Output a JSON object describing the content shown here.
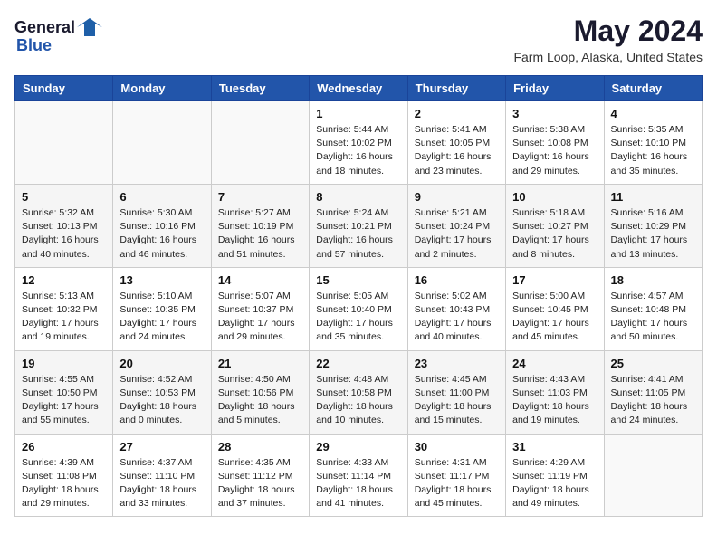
{
  "header": {
    "logo_general": "General",
    "logo_blue": "Blue",
    "title": "May 2024",
    "subtitle": "Farm Loop, Alaska, United States"
  },
  "days_of_week": [
    "Sunday",
    "Monday",
    "Tuesday",
    "Wednesday",
    "Thursday",
    "Friday",
    "Saturday"
  ],
  "weeks": [
    [
      {
        "day": "",
        "details": []
      },
      {
        "day": "",
        "details": []
      },
      {
        "day": "",
        "details": []
      },
      {
        "day": "1",
        "details": [
          "Sunrise: 5:44 AM",
          "Sunset: 10:02 PM",
          "Daylight: 16 hours",
          "and 18 minutes."
        ]
      },
      {
        "day": "2",
        "details": [
          "Sunrise: 5:41 AM",
          "Sunset: 10:05 PM",
          "Daylight: 16 hours",
          "and 23 minutes."
        ]
      },
      {
        "day": "3",
        "details": [
          "Sunrise: 5:38 AM",
          "Sunset: 10:08 PM",
          "Daylight: 16 hours",
          "and 29 minutes."
        ]
      },
      {
        "day": "4",
        "details": [
          "Sunrise: 5:35 AM",
          "Sunset: 10:10 PM",
          "Daylight: 16 hours",
          "and 35 minutes."
        ]
      }
    ],
    [
      {
        "day": "5",
        "details": [
          "Sunrise: 5:32 AM",
          "Sunset: 10:13 PM",
          "Daylight: 16 hours",
          "and 40 minutes."
        ]
      },
      {
        "day": "6",
        "details": [
          "Sunrise: 5:30 AM",
          "Sunset: 10:16 PM",
          "Daylight: 16 hours",
          "and 46 minutes."
        ]
      },
      {
        "day": "7",
        "details": [
          "Sunrise: 5:27 AM",
          "Sunset: 10:19 PM",
          "Daylight: 16 hours",
          "and 51 minutes."
        ]
      },
      {
        "day": "8",
        "details": [
          "Sunrise: 5:24 AM",
          "Sunset: 10:21 PM",
          "Daylight: 16 hours",
          "and 57 minutes."
        ]
      },
      {
        "day": "9",
        "details": [
          "Sunrise: 5:21 AM",
          "Sunset: 10:24 PM",
          "Daylight: 17 hours",
          "and 2 minutes."
        ]
      },
      {
        "day": "10",
        "details": [
          "Sunrise: 5:18 AM",
          "Sunset: 10:27 PM",
          "Daylight: 17 hours",
          "and 8 minutes."
        ]
      },
      {
        "day": "11",
        "details": [
          "Sunrise: 5:16 AM",
          "Sunset: 10:29 PM",
          "Daylight: 17 hours",
          "and 13 minutes."
        ]
      }
    ],
    [
      {
        "day": "12",
        "details": [
          "Sunrise: 5:13 AM",
          "Sunset: 10:32 PM",
          "Daylight: 17 hours",
          "and 19 minutes."
        ]
      },
      {
        "day": "13",
        "details": [
          "Sunrise: 5:10 AM",
          "Sunset: 10:35 PM",
          "Daylight: 17 hours",
          "and 24 minutes."
        ]
      },
      {
        "day": "14",
        "details": [
          "Sunrise: 5:07 AM",
          "Sunset: 10:37 PM",
          "Daylight: 17 hours",
          "and 29 minutes."
        ]
      },
      {
        "day": "15",
        "details": [
          "Sunrise: 5:05 AM",
          "Sunset: 10:40 PM",
          "Daylight: 17 hours",
          "and 35 minutes."
        ]
      },
      {
        "day": "16",
        "details": [
          "Sunrise: 5:02 AM",
          "Sunset: 10:43 PM",
          "Daylight: 17 hours",
          "and 40 minutes."
        ]
      },
      {
        "day": "17",
        "details": [
          "Sunrise: 5:00 AM",
          "Sunset: 10:45 PM",
          "Daylight: 17 hours",
          "and 45 minutes."
        ]
      },
      {
        "day": "18",
        "details": [
          "Sunrise: 4:57 AM",
          "Sunset: 10:48 PM",
          "Daylight: 17 hours",
          "and 50 minutes."
        ]
      }
    ],
    [
      {
        "day": "19",
        "details": [
          "Sunrise: 4:55 AM",
          "Sunset: 10:50 PM",
          "Daylight: 17 hours",
          "and 55 minutes."
        ]
      },
      {
        "day": "20",
        "details": [
          "Sunrise: 4:52 AM",
          "Sunset: 10:53 PM",
          "Daylight: 18 hours",
          "and 0 minutes."
        ]
      },
      {
        "day": "21",
        "details": [
          "Sunrise: 4:50 AM",
          "Sunset: 10:56 PM",
          "Daylight: 18 hours",
          "and 5 minutes."
        ]
      },
      {
        "day": "22",
        "details": [
          "Sunrise: 4:48 AM",
          "Sunset: 10:58 PM",
          "Daylight: 18 hours",
          "and 10 minutes."
        ]
      },
      {
        "day": "23",
        "details": [
          "Sunrise: 4:45 AM",
          "Sunset: 11:00 PM",
          "Daylight: 18 hours",
          "and 15 minutes."
        ]
      },
      {
        "day": "24",
        "details": [
          "Sunrise: 4:43 AM",
          "Sunset: 11:03 PM",
          "Daylight: 18 hours",
          "and 19 minutes."
        ]
      },
      {
        "day": "25",
        "details": [
          "Sunrise: 4:41 AM",
          "Sunset: 11:05 PM",
          "Daylight: 18 hours",
          "and 24 minutes."
        ]
      }
    ],
    [
      {
        "day": "26",
        "details": [
          "Sunrise: 4:39 AM",
          "Sunset: 11:08 PM",
          "Daylight: 18 hours",
          "and 29 minutes."
        ]
      },
      {
        "day": "27",
        "details": [
          "Sunrise: 4:37 AM",
          "Sunset: 11:10 PM",
          "Daylight: 18 hours",
          "and 33 minutes."
        ]
      },
      {
        "day": "28",
        "details": [
          "Sunrise: 4:35 AM",
          "Sunset: 11:12 PM",
          "Daylight: 18 hours",
          "and 37 minutes."
        ]
      },
      {
        "day": "29",
        "details": [
          "Sunrise: 4:33 AM",
          "Sunset: 11:14 PM",
          "Daylight: 18 hours",
          "and 41 minutes."
        ]
      },
      {
        "day": "30",
        "details": [
          "Sunrise: 4:31 AM",
          "Sunset: 11:17 PM",
          "Daylight: 18 hours",
          "and 45 minutes."
        ]
      },
      {
        "day": "31",
        "details": [
          "Sunrise: 4:29 AM",
          "Sunset: 11:19 PM",
          "Daylight: 18 hours",
          "and 49 minutes."
        ]
      },
      {
        "day": "",
        "details": []
      }
    ]
  ]
}
